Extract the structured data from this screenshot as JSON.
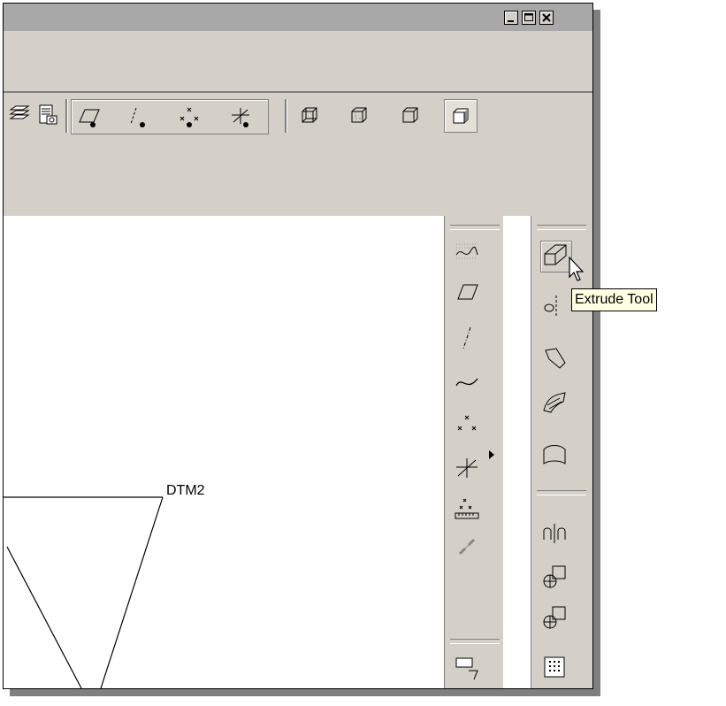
{
  "window": {
    "controls": [
      "_",
      "□",
      "×"
    ]
  },
  "toolbar": {
    "icons": [
      "layers-icon",
      "saved-view-icon",
      "datum-plane-display-icon",
      "datum-axis-display-icon",
      "datum-point-display-icon",
      "coordinate-system-display-icon",
      "wireframe-icon",
      "hidden-line-icon",
      "no-hidden-icon",
      "shading-icon"
    ],
    "active": "shading-icon"
  },
  "datum_toolbar": {
    "icons": [
      "sketched-datum-curve-icon",
      "datum-plane-tool-icon",
      "datum-axis-tool-icon",
      "datum-curve-tool-icon",
      "datum-point-tool-icon",
      "coordinate-system-tool-icon",
      "offset-datum-point-icon",
      "analysis-feature-icon",
      "note-icon"
    ]
  },
  "feature_toolbar": {
    "icons": [
      "extrude-tool-icon",
      "revolve-tool-icon",
      "variable-section-sweep-icon",
      "boundary-blend-icon",
      "style-icon",
      "mirror-tool-icon",
      "merge-tool-icon",
      "trim-tool-icon",
      "pattern-tool-icon"
    ],
    "hovered": "extrude-tool-icon"
  },
  "tooltip": {
    "text": "Extrude Tool"
  },
  "canvas": {
    "datum_label": "DTM2"
  },
  "colors": {
    "face": "#d4d0c8",
    "titlebar": "#a8a8a8",
    "tooltip_bg": "#ffffe1"
  }
}
